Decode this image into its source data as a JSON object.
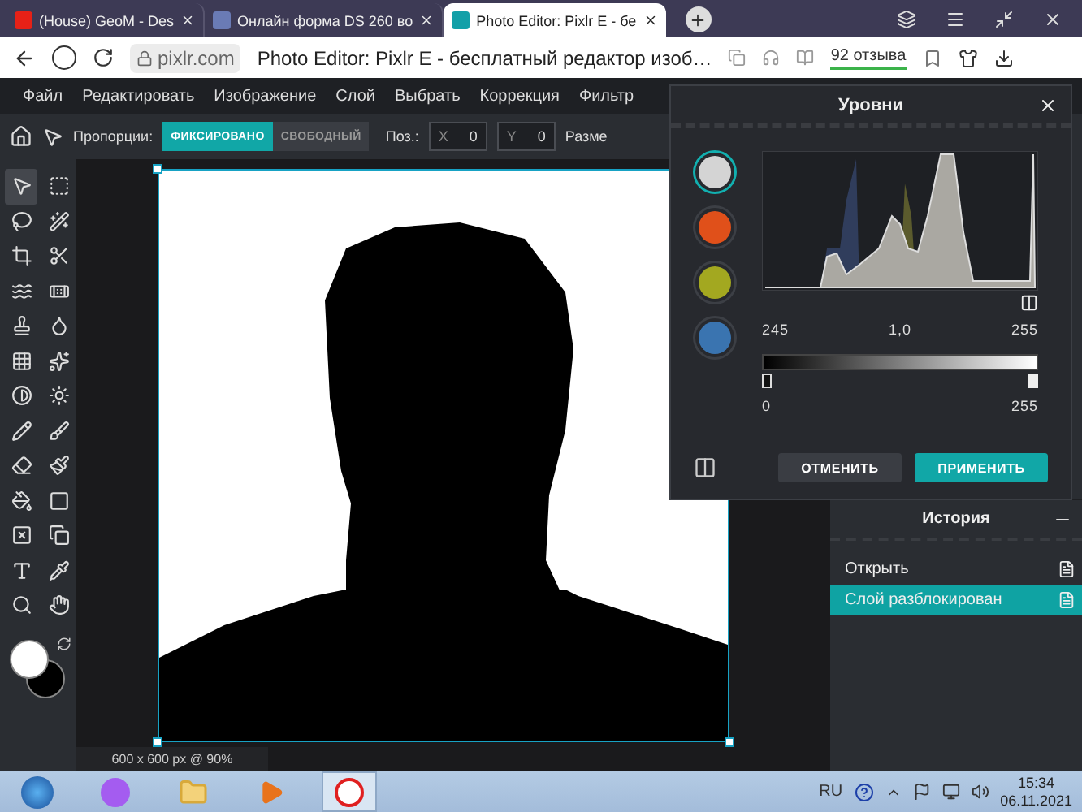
{
  "browser": {
    "tabs": [
      {
        "title": "(House) GeoM - Des",
        "selected": false
      },
      {
        "title": "Онлайн форма DS 260 во",
        "selected": false
      },
      {
        "title": "Photo Editor: Pixlr E - бе",
        "selected": true
      }
    ],
    "address": {
      "domain": "pixlr.com",
      "page_title": "Photo Editor: Pixlr E - бесплатный редактор изоб…",
      "reviews": "92 отзыва"
    }
  },
  "menu": [
    "Файл",
    "Редактировать",
    "Изображение",
    "Слой",
    "Выбрать",
    "Коррекция",
    "Фильтр"
  ],
  "options": {
    "proportions_label": "Пропорции:",
    "modes": [
      {
        "label": "ФИКСИРОВАНО",
        "selected": true
      },
      {
        "label": "СВОБОДНЫЙ",
        "selected": false
      }
    ],
    "position_label": "Поз.:",
    "x": {
      "placeholder": "X",
      "value": "0"
    },
    "y": {
      "placeholder": "Y",
      "value": "0"
    },
    "size_label": "Разме"
  },
  "canvas": {
    "status": "600 x 600 px @ 90%"
  },
  "levels_dialog": {
    "title": "Уровни",
    "channels": [
      {
        "color": "#d4d4d4",
        "selected": true
      },
      {
        "color": "#e0501a",
        "selected": false
      },
      {
        "color": "#a3a820",
        "selected": false
      },
      {
        "color": "#3a74b0",
        "selected": false
      }
    ],
    "input_black": "245",
    "gamma": "1,0",
    "input_white": "255",
    "output_black": "0",
    "output_white": "255",
    "cancel": "ОТМЕНИТЬ",
    "apply": "ПРИМЕНИТЬ"
  },
  "history": {
    "title": "История",
    "items": [
      {
        "label": "Открыть",
        "selected": false
      },
      {
        "label": "Слой разблокирован",
        "selected": true
      }
    ]
  },
  "taskbar": {
    "language": "RU",
    "time": "15:34",
    "date": "06.11.2021"
  }
}
